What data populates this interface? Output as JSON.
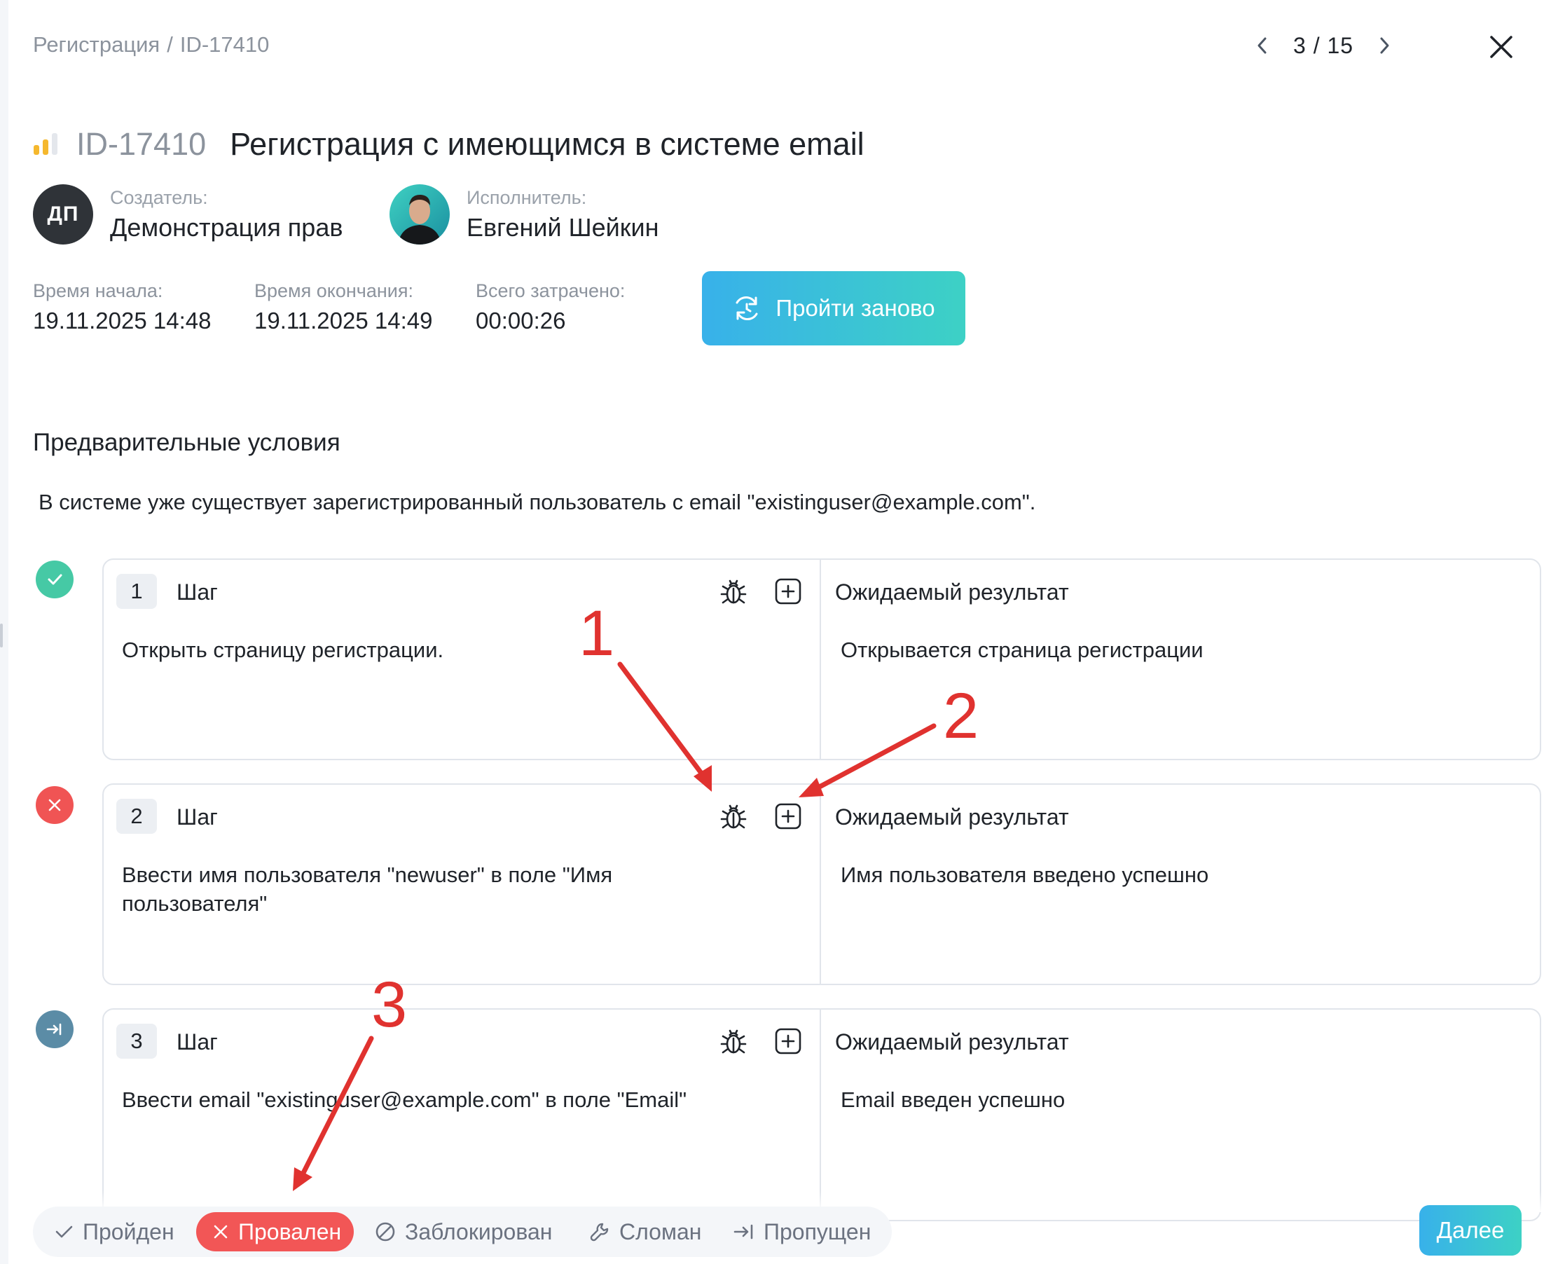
{
  "breadcrumb": {
    "section": "Регистрация",
    "separator": "/",
    "case_id": "ID-17410"
  },
  "pager": {
    "current": "3",
    "total": "15",
    "separator": "/"
  },
  "case": {
    "id": "ID-17410",
    "title": "Регистрация с имеющимся в системе email",
    "priority_color": "#f5b82e"
  },
  "creator": {
    "label": "Создатель:",
    "name": "Демонстрация прав",
    "initials": "ДП"
  },
  "assignee": {
    "label": "Исполнитель:",
    "name": "Евгений Шейкин"
  },
  "timing": {
    "start_label": "Время начала:",
    "start_value": "19.11.2025 14:48",
    "end_label": "Время окончания:",
    "end_value": "19.11.2025 14:49",
    "total_label": "Всего затрачено:",
    "total_value": "00:00:26"
  },
  "rerun_button": "Пройти заново",
  "preconditions": {
    "title": "Предварительные условия",
    "text": "В системе уже существует зарегистрированный пользователь с email \"existinguser@example.com\"."
  },
  "steps": [
    {
      "number": "1",
      "step_label": "Шаг",
      "status": "passed",
      "text": "Открыть страницу регистрации.",
      "expected_label": "Ожидаемый результат",
      "expected": "Открывается страница регистрации"
    },
    {
      "number": "2",
      "step_label": "Шаг",
      "status": "failed",
      "text": "Ввести имя пользователя \"newuser\" в поле \"Имя пользователя\"",
      "expected_label": "Ожидаемый результат",
      "expected": "Имя пользователя введено успешно"
    },
    {
      "number": "3",
      "step_label": "Шаг",
      "status": "skipped",
      "text": "Ввести email \"existinguser@example.com\" в поле \"Email\"",
      "expected_label": "Ожидаемый результат",
      "expected": "Email введен успешно"
    }
  ],
  "status_options": {
    "passed": "Пройден",
    "failed": "Провален",
    "blocked": "Заблокирован",
    "broken": "Сломан",
    "skipped": "Пропущен",
    "selected": "failed"
  },
  "next_button": "Далее",
  "annotations": {
    "a1": "1",
    "a2": "2",
    "a3": "3",
    "color": "#e0322f"
  },
  "colors": {
    "accent_from": "#38b1ea",
    "accent_to": "#3dd1c5",
    "passed": "#46c9a5",
    "failed": "#f05454",
    "skipped": "#5b8ca6"
  }
}
